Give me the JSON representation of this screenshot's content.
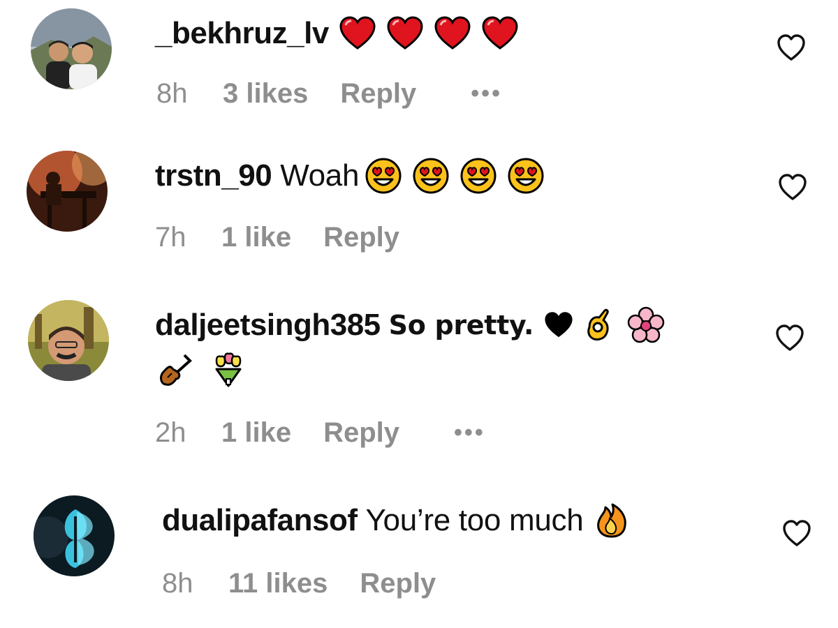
{
  "comments": [
    {
      "username": "_bekhruz_lv",
      "text": "",
      "emoji_icons": [
        "red-heart-icon",
        "red-heart-icon",
        "red-heart-icon",
        "red-heart-icon"
      ],
      "time": "8h",
      "likes": "3 likes",
      "reply_label": "Reply",
      "more_label": "•••"
    },
    {
      "username": "trstn_90",
      "text": "Woah",
      "emoji_icons": [
        "heart-eyes-face-icon",
        "heart-eyes-face-icon",
        "heart-eyes-face-icon",
        "heart-eyes-face-icon"
      ],
      "time": "7h",
      "likes": "1 like",
      "reply_label": "Reply"
    },
    {
      "username": "daljeetsingh385",
      "text": "So pretty.",
      "emoji_icons": [
        "black-heart-icon",
        "ok-hand-icon",
        "cherry-blossom-icon",
        "violin-icon",
        "tulip-bouquet-icon"
      ],
      "time": "2h",
      "likes": "1 like",
      "reply_label": "Reply",
      "more_label": "•••"
    },
    {
      "username": "dualipafansof",
      "text": "You’re too much",
      "emoji_icons": [
        "fire-icon"
      ],
      "time": "8h",
      "likes": "11 likes",
      "reply_label": "Reply"
    }
  ],
  "colors": {
    "meta_text": "#8e8e8e",
    "primary_text": "#111111",
    "heart_red": "#e0141e",
    "emoji_yellow": "#fcc21b"
  }
}
